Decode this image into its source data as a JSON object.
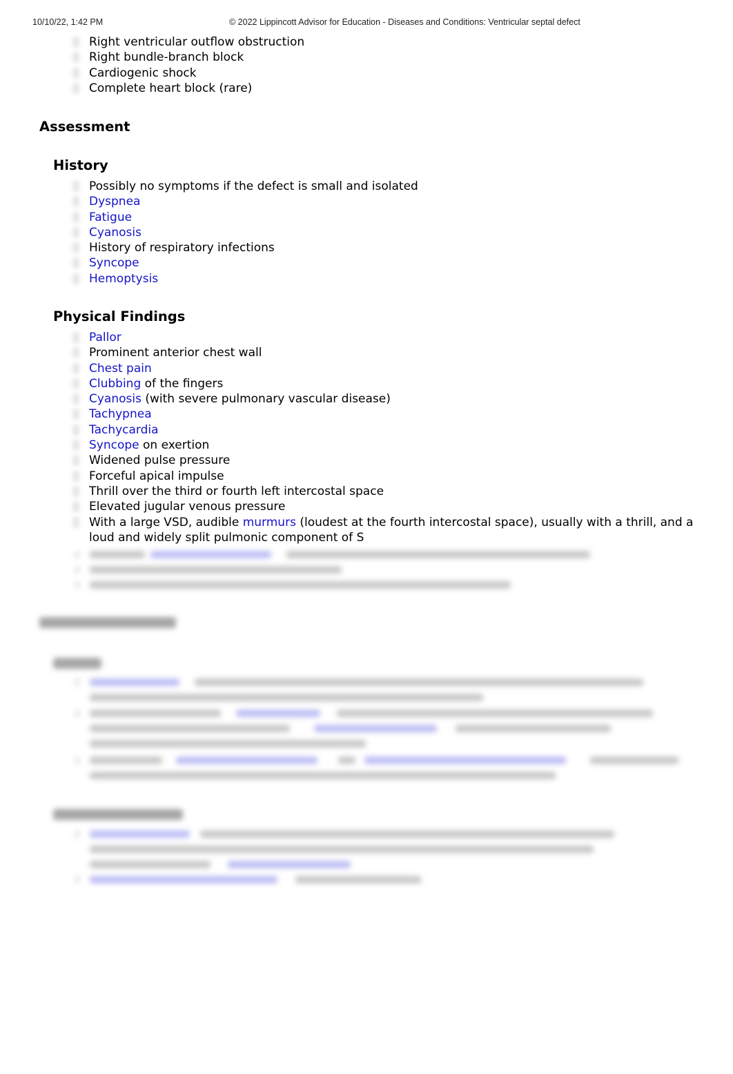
{
  "print_header": {
    "date_time": "10/10/22, 1:42 PM",
    "title": "© 2022 Lippincott Advisor for Education - Diseases and Conditions: Ventricular septal defect"
  },
  "complications_continued": [
    {
      "parts": [
        {
          "text": "Right ventricular outflow obstruction",
          "link": false
        }
      ]
    },
    {
      "parts": [
        {
          "text": "Right bundle-branch block",
          "link": false
        }
      ]
    },
    {
      "parts": [
        {
          "text": "Cardiogenic shock",
          "link": false
        }
      ]
    },
    {
      "parts": [
        {
          "text": "Complete heart block (rare)",
          "link": false
        }
      ]
    }
  ],
  "assessment": {
    "heading": "Assessment",
    "history": {
      "heading": "History",
      "items": [
        {
          "parts": [
            {
              "text": "Possibly no symptoms if the defect is small and isolated",
              "link": false
            }
          ]
        },
        {
          "parts": [
            {
              "text": "Dyspnea",
              "link": true
            }
          ]
        },
        {
          "parts": [
            {
              "text": "Fatigue",
              "link": true
            }
          ]
        },
        {
          "parts": [
            {
              "text": "Cyanosis",
              "link": true
            }
          ]
        },
        {
          "parts": [
            {
              "text": "History of respiratory infections",
              "link": false
            }
          ]
        },
        {
          "parts": [
            {
              "text": "Syncope",
              "link": true
            }
          ]
        },
        {
          "parts": [
            {
              "text": "Hemoptysis",
              "link": true
            }
          ]
        }
      ]
    },
    "physical_findings": {
      "heading": "Physical Findings",
      "items": [
        {
          "parts": [
            {
              "text": "Pallor",
              "link": true
            }
          ]
        },
        {
          "parts": [
            {
              "text": "Prominent anterior chest wall",
              "link": false
            }
          ]
        },
        {
          "parts": [
            {
              "text": "Chest pain",
              "link": true
            }
          ]
        },
        {
          "parts": [
            {
              "text": "Clubbing",
              "link": true
            },
            {
              "text": " of the fingers",
              "link": false
            }
          ]
        },
        {
          "parts": [
            {
              "text": "Cyanosis",
              "link": true
            },
            {
              "text": " (with severe pulmonary vascular disease)",
              "link": false
            }
          ]
        },
        {
          "parts": [
            {
              "text": "Tachypnea",
              "link": true
            }
          ]
        },
        {
          "parts": [
            {
              "text": "Tachycardia",
              "link": true
            }
          ]
        },
        {
          "parts": [
            {
              "text": "Syncope",
              "link": true
            },
            {
              "text": " on exertion",
              "link": false
            }
          ]
        },
        {
          "parts": [
            {
              "text": "Widened pulse pressure",
              "link": false
            }
          ]
        },
        {
          "parts": [
            {
              "text": "Forceful apical impulse",
              "link": false
            }
          ]
        },
        {
          "parts": [
            {
              "text": "Thrill over the third or fourth left intercostal space",
              "link": false
            }
          ]
        },
        {
          "parts": [
            {
              "text": "Elevated jugular venous pressure",
              "link": false
            }
          ]
        },
        {
          "parts": [
            {
              "text": "With a large VSD, audible ",
              "link": false
            },
            {
              "text": "murmurs",
              "link": true
            },
            {
              "text": " (loudest at the fourth intercostal space), usually with a thrill, and a loud and widely split pulmonic component of S",
              "link": false
            }
          ]
        }
      ]
    }
  },
  "colors": {
    "link": "#1414c8",
    "text": "#000000",
    "header_text": "#222222"
  },
  "blurred_section": {
    "note": "content below is obscured (blurred) and not legible"
  }
}
